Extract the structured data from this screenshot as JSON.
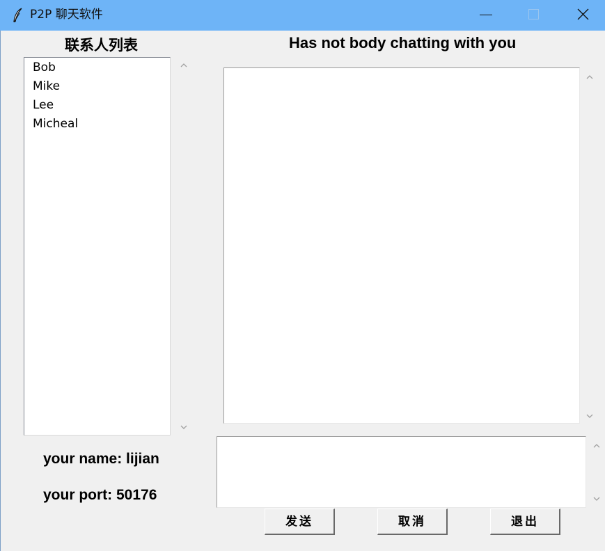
{
  "window": {
    "title": "P2P 聊天软件",
    "titlebar_color": "#6eb4f7",
    "icons": [
      "feather-icon",
      "minimize-icon",
      "maximize-icon",
      "close-icon"
    ]
  },
  "contacts_panel": {
    "heading": "联系人列表",
    "items": [
      {
        "label": "Bob"
      },
      {
        "label": "Mike"
      },
      {
        "label": "Lee"
      },
      {
        "label": "Micheal"
      }
    ]
  },
  "chat_panel": {
    "heading": "Has not body chatting with you"
  },
  "user_info": {
    "name_text": "your name: lijian",
    "port_text": "your port: 50176"
  },
  "buttons": {
    "send": "发送",
    "cancel": "取消",
    "exit": "退出"
  }
}
